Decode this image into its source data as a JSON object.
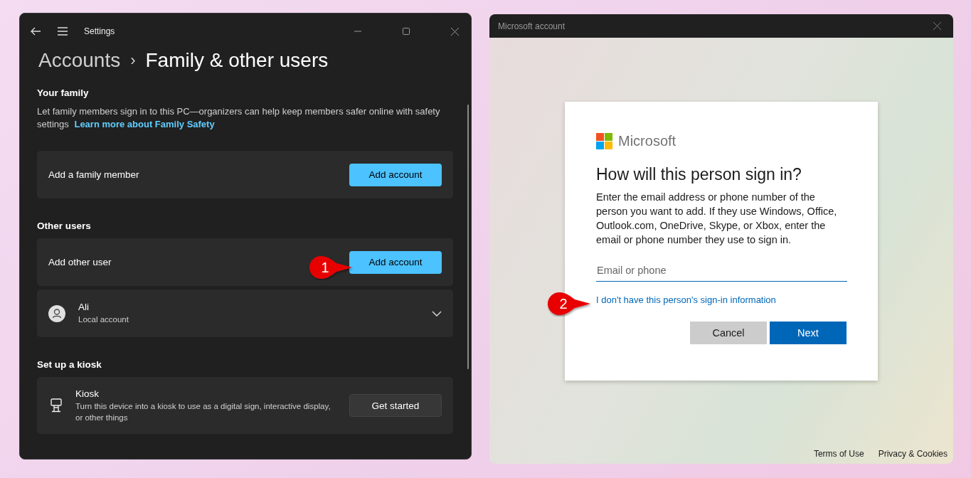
{
  "settings_window": {
    "title": "Settings",
    "breadcrumb": {
      "parent": "Accounts",
      "separator": "›",
      "current": "Family & other users"
    },
    "sections": [
      {
        "heading": "Your family",
        "description": "Let family members sign in to this PC—organizers can help keep members safer online with safety settings",
        "link": "Learn more about Family Safety",
        "cards": [
          {
            "kind": "action",
            "label": "Add a family member",
            "button": "Add account",
            "accent": true
          }
        ]
      },
      {
        "heading": "Other users",
        "cards": [
          {
            "kind": "action",
            "label": "Add other user",
            "button": "Add account",
            "accent": true
          },
          {
            "kind": "user",
            "name": "Ali",
            "subtitle": "Local account",
            "expanded": false
          }
        ]
      },
      {
        "heading": "Set up a kiosk",
        "cards": [
          {
            "kind": "kiosk",
            "title": "Kiosk",
            "subtitle": "Turn this device into a kiosk to use as a digital sign, interactive display, or other things",
            "button": "Get started",
            "accent": false
          }
        ]
      }
    ]
  },
  "account_window": {
    "title": "Microsoft account",
    "dialog": {
      "brand": "Microsoft",
      "heading": "How will this person sign in?",
      "body": "Enter the email address or phone number of the person you want to add. If they use Windows, Office, Outlook.com, OneDrive, Skype, or Xbox, enter the email or phone number they use to sign in.",
      "input": {
        "placeholder": "Email or phone"
      },
      "link": "I don't have this person's sign-in information",
      "buttons": [
        {
          "label": "Cancel",
          "kind": "secondary"
        },
        {
          "label": "Next",
          "kind": "primary"
        }
      ]
    },
    "footer_links": [
      "Terms of Use",
      "Privacy & Cookies"
    ]
  },
  "callouts": [
    {
      "number": "1"
    },
    {
      "number": "2"
    }
  ]
}
